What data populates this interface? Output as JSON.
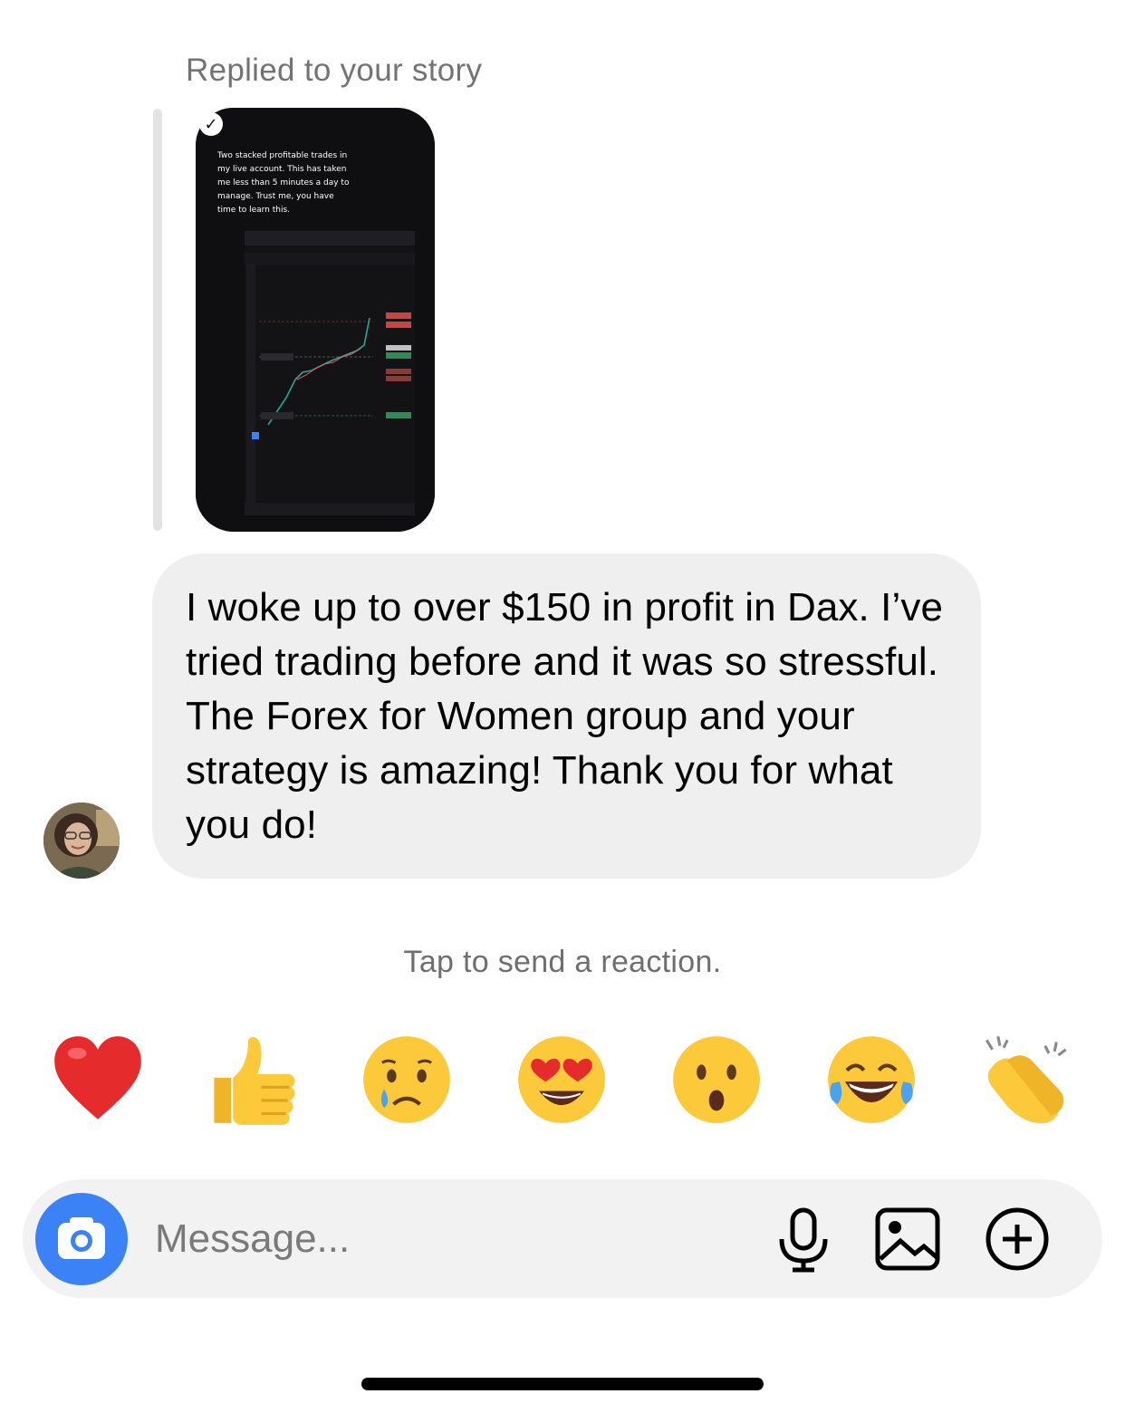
{
  "thread": {
    "reply_label": "Replied to your story",
    "story_caption": "Two stacked profitable trades in my live account. This has taken me less than 5 minutes a day to manage. Trust me, you have time to learn this.",
    "message_text": "I woke up to over $150 in profit in Dax. I’ve tried trading before and it was so stressful. The Forex for Women group and your strategy is amazing! Thank you for what you do!"
  },
  "reactions": {
    "hint": "Tap to send a reaction.",
    "items": [
      "heart-icon",
      "thumbs-up-icon",
      "crying-face-icon",
      "heart-eyes-icon",
      "surprised-face-icon",
      "laughing-tears-icon",
      "clapping-hands-icon"
    ]
  },
  "composer": {
    "placeholder": "Message...",
    "icons": [
      "camera-icon",
      "microphone-icon",
      "gallery-icon",
      "plus-circle-icon"
    ],
    "accent": "#3b82f6"
  }
}
